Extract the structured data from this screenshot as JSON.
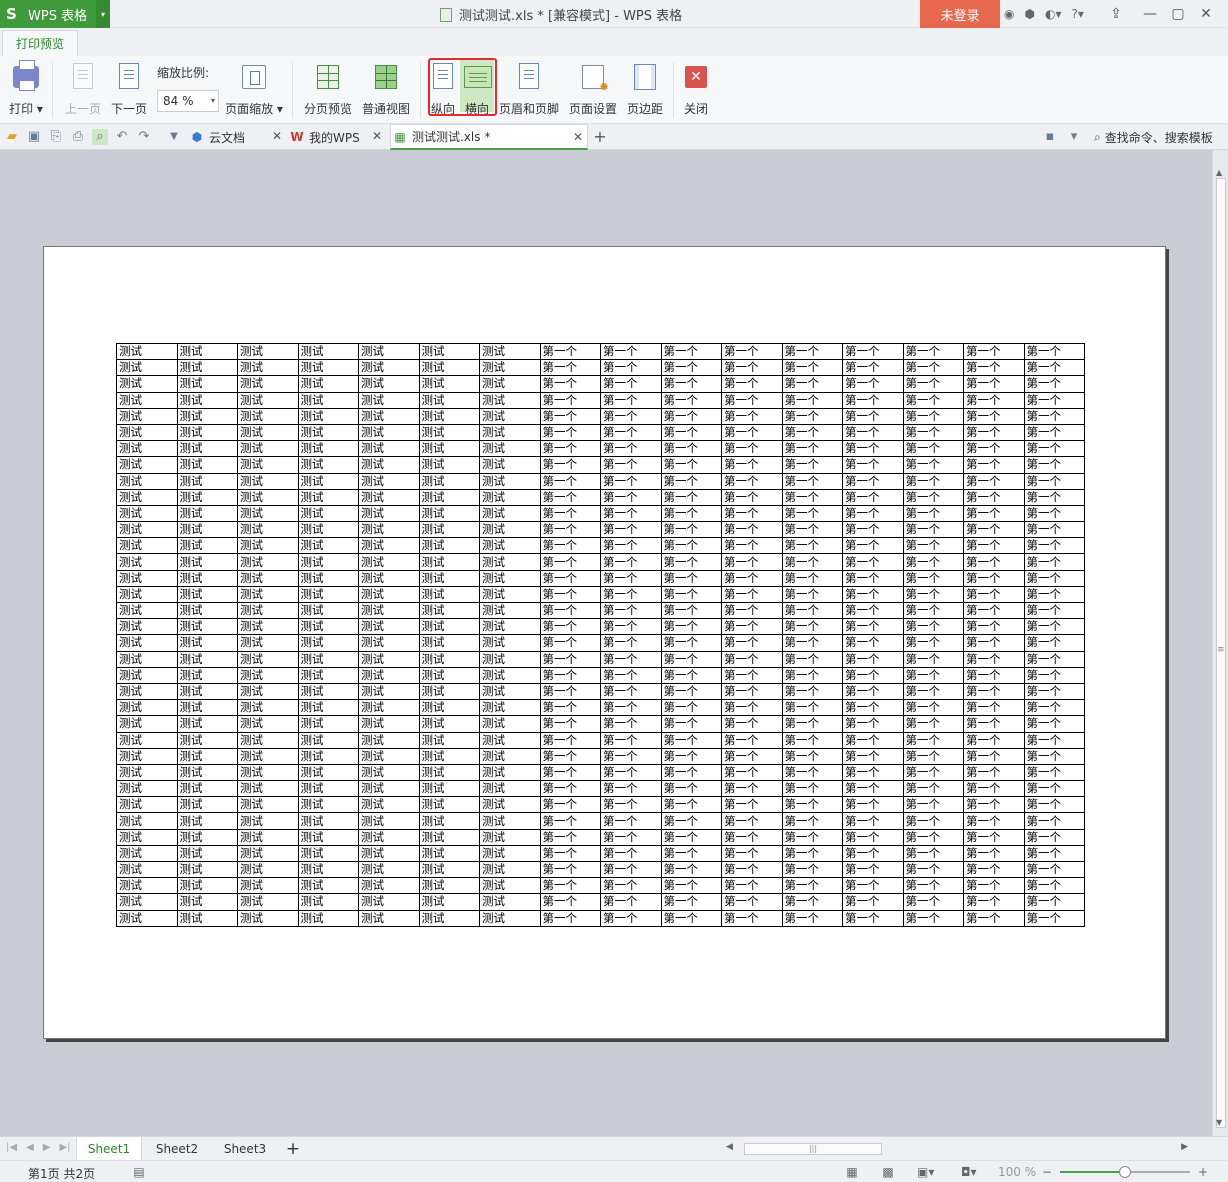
{
  "titlebar": {
    "app_name": "WPS 表格",
    "app_logo": "S",
    "doc_title": "测试测试.xls * [兼容模式] - WPS 表格",
    "login_label": "未登录",
    "help_label": "?"
  },
  "ribbon_tabs": {
    "active": "打印预览"
  },
  "ribbon": {
    "print_label": "打印",
    "prev_page_label": "上一页",
    "next_page_label": "下一页",
    "zoom_caption": "缩放比例:",
    "zoom_value": "84 %",
    "page_scale_label": "页面缩放",
    "page_break_preview_label": "分页预览",
    "normal_view_label": "普通视图",
    "portrait_label": "纵向",
    "landscape_label": "横向",
    "header_footer_label": "页眉和页脚",
    "page_setup_label": "页面设置",
    "margins_label": "页边距",
    "close_label": "关闭"
  },
  "doc_tabs": [
    {
      "label": "云文档"
    },
    {
      "label": "我的WPS"
    },
    {
      "label": "测试测试.xls *"
    }
  ],
  "search": {
    "label": "查找命令、搜索模板"
  },
  "sheet": {
    "rows": 36,
    "test_cols": 7,
    "first_cols": 9,
    "test_text": "测试",
    "first_text": "第一个"
  },
  "sheet_tabs": [
    {
      "label": "Sheet1",
      "active": true
    },
    {
      "label": "Sheet2",
      "active": false
    },
    {
      "label": "Sheet3",
      "active": false
    }
  ],
  "status": {
    "page_info": "第1页 共2页",
    "zoom_percent": "100 %",
    "zoom_level": 0.5
  },
  "colors": {
    "accent_green": "#3f9a3c",
    "login_red": "#e8674f",
    "highlight_red": "#e32b2b"
  }
}
